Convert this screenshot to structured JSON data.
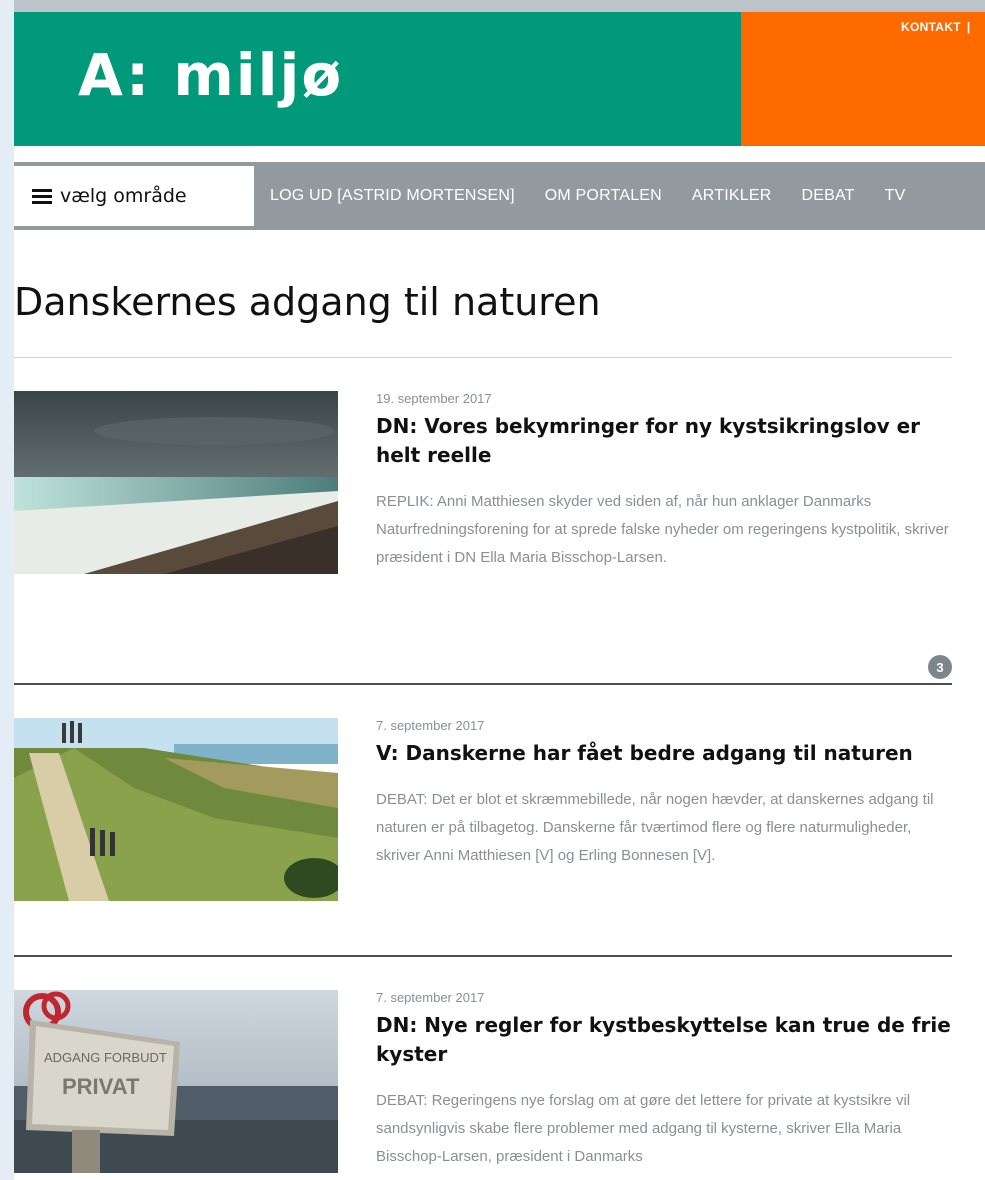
{
  "header": {
    "logo": "A: miljø",
    "contact": "KONTAKT",
    "separator": "|"
  },
  "nav": {
    "area_label": "vælg område",
    "links": [
      "LOG UD [ASTRID MORTENSEN]",
      "OM PORTALEN",
      "ARTIKLER",
      "DEBAT",
      "TV"
    ]
  },
  "page_title": "Danskernes adgang til naturen",
  "articles": [
    {
      "date": "19. september 2017",
      "title": "DN: Vores bekymringer for ny kystsikringslov er helt reelle",
      "teaser": "REPLIK: Anni Matthiesen skyder ved siden af, når hun anklager Danmarks Naturfredningsforening for at sprede falske nyheder om regeringens kystpolitik, skriver præsident i DN Ella Maria Bisschop-Larsen.",
      "comments": "3"
    },
    {
      "date": "7. september 2017",
      "title": "V: Danskerne har fået bedre adgang til naturen",
      "teaser": "DEBAT: Det er blot et skræmmebillede, når nogen hævder, at danskernes adgang til naturen er på tilbagetog. Danskerne får tværtimod flere og flere naturmuligheder, skriver Anni Matthiesen [V] og Erling Bonnesen [V]."
    },
    {
      "date": "7. september 2017",
      "title": "DN: Nye regler for kystbeskyttelse kan true de frie kyster",
      "teaser": "DEBAT: Regeringens nye forslag om at gøre det lettere for private at kystsikre vil sandsynligvis skabe flere problemer med adgang til kysterne, skriver Ella Maria Bisschop-Larsen, præsident i Danmarks",
      "sign_text_1": "ADGANG FORBUDT",
      "sign_text_2": "PRIVAT"
    }
  ],
  "colors": {
    "brand_green": "#00997a",
    "brand_orange": "#ff6a00",
    "nav_grey": "#939a9f"
  }
}
